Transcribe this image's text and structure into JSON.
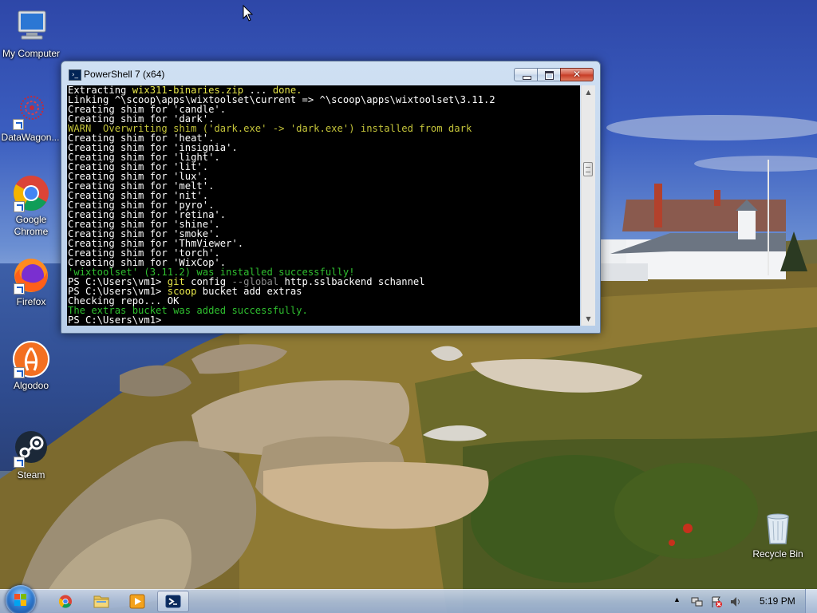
{
  "desktop": {
    "icons": [
      {
        "label": "My Computer"
      },
      {
        "label": "DataWagon..."
      },
      {
        "label": "Google Chrome"
      },
      {
        "label": "Firefox"
      },
      {
        "label": "Algodoo"
      },
      {
        "label": "Steam"
      },
      {
        "label": "Recycle Bin"
      }
    ]
  },
  "window": {
    "title": "PowerShell 7 (x64)",
    "console_lines": [
      [
        [
          "w",
          "Extracting "
        ],
        [
          "y",
          "wix311-binaries.zip"
        ],
        [
          "w",
          " ... "
        ],
        [
          "y",
          "done."
        ]
      ],
      [
        [
          "w",
          "Linking ^\\scoop\\apps\\wixtoolset\\current => ^\\scoop\\apps\\wixtoolset\\3.11.2"
        ]
      ],
      [
        [
          "w",
          "Creating shim for 'candle'."
        ]
      ],
      [
        [
          "w",
          "Creating shim for 'dark'."
        ]
      ],
      [
        [
          "wr",
          "WARN  Overwriting shim ('dark.exe' -> 'dark.exe') installed from dark"
        ]
      ],
      [
        [
          "w",
          "Creating shim for 'heat'."
        ]
      ],
      [
        [
          "w",
          "Creating shim for 'insignia'."
        ]
      ],
      [
        [
          "w",
          "Creating shim for 'light'."
        ]
      ],
      [
        [
          "w",
          "Creating shim for 'lit'."
        ]
      ],
      [
        [
          "w",
          "Creating shim for 'lux'."
        ]
      ],
      [
        [
          "w",
          "Creating shim for 'melt'."
        ]
      ],
      [
        [
          "w",
          "Creating shim for 'nit'."
        ]
      ],
      [
        [
          "w",
          "Creating shim for 'pyro'."
        ]
      ],
      [
        [
          "w",
          "Creating shim for 'retina'."
        ]
      ],
      [
        [
          "w",
          "Creating shim for 'shine'."
        ]
      ],
      [
        [
          "w",
          "Creating shim for 'smoke'."
        ]
      ],
      [
        [
          "w",
          "Creating shim for 'ThmViewer'."
        ]
      ],
      [
        [
          "w",
          "Creating shim for 'torch'."
        ]
      ],
      [
        [
          "w",
          "Creating shim for 'WixCop'."
        ]
      ],
      [
        [
          "g",
          "'wixtoolset' (3.11.2) was installed successfully!"
        ]
      ],
      [
        [
          "w",
          "PS C:\\Users\\vm1> "
        ],
        [
          "y",
          "git"
        ],
        [
          "w",
          " config "
        ],
        [
          "dg",
          "--global"
        ],
        [
          "w",
          " http.sslbackend schannel"
        ]
      ],
      [
        [
          "w",
          "PS C:\\Users\\vm1> "
        ],
        [
          "y",
          "scoop"
        ],
        [
          "w",
          " bucket add extras"
        ]
      ],
      [
        [
          "w",
          "Checking repo... OK"
        ]
      ],
      [
        [
          "g",
          "The extras bucket was added successfully."
        ]
      ],
      [
        [
          "w",
          "PS C:\\Users\\vm1> "
        ]
      ]
    ]
  },
  "taskbar": {
    "apps": [
      {
        "icon": "chrome-icon"
      },
      {
        "icon": "file-explorer-icon"
      },
      {
        "icon": "media-player-icon"
      },
      {
        "icon": "powershell-icon",
        "active": true
      }
    ],
    "clock": "5:19 PM",
    "tray_icons": [
      "show-hidden-icons-arrow",
      "network-icon",
      "action-center-flag-icon",
      "volume-icon"
    ]
  },
  "colors": {
    "console_bg": "#000000",
    "console_fg": "#ffffff",
    "highlight_yellow": "#e5e54a",
    "success_green": "#2fbf2f",
    "warn_yellow": "#c4c43a"
  }
}
